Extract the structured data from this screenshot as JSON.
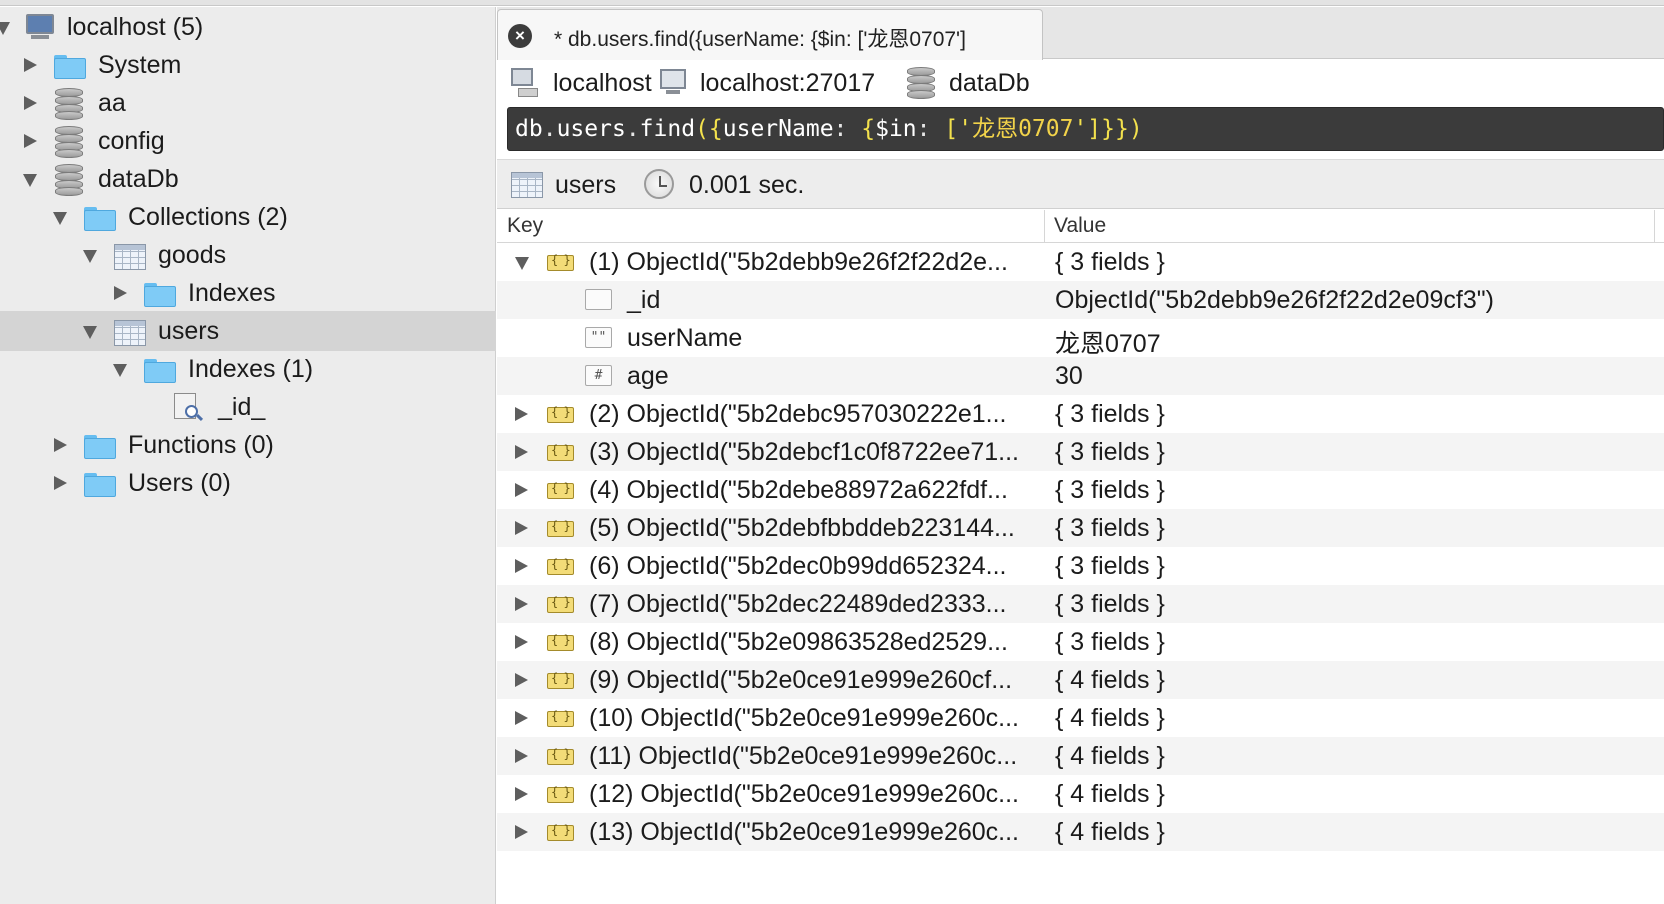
{
  "sidebar": {
    "host": {
      "label": "localhost (5)"
    },
    "items": [
      {
        "label": "System"
      },
      {
        "label": "aa"
      },
      {
        "label": "config"
      },
      {
        "label": "dataDb"
      },
      {
        "label": "Collections (2)"
      },
      {
        "label": "goods"
      },
      {
        "label": "Indexes"
      },
      {
        "label": "users"
      },
      {
        "label": "Indexes (1)"
      },
      {
        "label": "_id_"
      },
      {
        "label": "Functions (0)"
      },
      {
        "label": "Users (0)"
      }
    ]
  },
  "tab": {
    "title": "* db.users.find({userName: {$in: ['龙恩0707']",
    "close_icon": "×"
  },
  "connection": {
    "server": "localhost",
    "host": "localhost:27017",
    "database": "dataDb"
  },
  "query": {
    "p1": "db",
    "p2": ".",
    "p3": "users",
    "p4": ".",
    "p5": "find",
    "p6": "({",
    "p7": "userName",
    "p8": ": ",
    "p9": "{",
    "p10": "$in",
    "p11": ": ",
    "p12": "['",
    "p13": "龙恩0707",
    "p14": "']",
    "p15": "}})"
  },
  "result": {
    "collection": "users",
    "time": "0.001 sec."
  },
  "table": {
    "headers": {
      "key": "Key",
      "value": "Value"
    },
    "rows": [
      {
        "key": "(1) ObjectId(\"5b2debb9e26f2f22d2e...",
        "value": "{ 3 fields }"
      },
      {
        "key": "_id",
        "value": "ObjectId(\"5b2debb9e26f2f22d2e09cf3\")",
        "type_glyph": ""
      },
      {
        "key": "userName",
        "value": "龙恩0707",
        "type_glyph": "\"\""
      },
      {
        "key": "age",
        "value": "30",
        "type_glyph": "#"
      },
      {
        "key": "(2) ObjectId(\"5b2debc957030222e1...",
        "value": "{ 3 fields }"
      },
      {
        "key": "(3) ObjectId(\"5b2debcf1c0f8722ee71...",
        "value": "{ 3 fields }"
      },
      {
        "key": "(4) ObjectId(\"5b2debe88972a622fdf...",
        "value": "{ 3 fields }"
      },
      {
        "key": "(5) ObjectId(\"5b2debfbbddeb223144...",
        "value": "{ 3 fields }"
      },
      {
        "key": "(6) ObjectId(\"5b2dec0b99dd652324...",
        "value": "{ 3 fields }"
      },
      {
        "key": "(7) ObjectId(\"5b2dec22489ded2333...",
        "value": "{ 3 fields }"
      },
      {
        "key": "(8) ObjectId(\"5b2e09863528ed2529...",
        "value": "{ 3 fields }"
      },
      {
        "key": "(9) ObjectId(\"5b2e0ce91e999e260cf...",
        "value": "{ 4 fields }"
      },
      {
        "key": "(10) ObjectId(\"5b2e0ce91e999e260c...",
        "value": "{ 4 fields }"
      },
      {
        "key": "(11) ObjectId(\"5b2e0ce91e999e260c...",
        "value": "{ 4 fields }"
      },
      {
        "key": "(12) ObjectId(\"5b2e0ce91e999e260c...",
        "value": "{ 4 fields }"
      },
      {
        "key": "(13) ObjectId(\"5b2e0ce91e999e260c...",
        "value": "{ 4 fields }"
      }
    ]
  },
  "colors": {
    "query_bg": "#3b3b3b",
    "query_bracket": "#f3e14d",
    "folder": "#7fcbf6",
    "selected_row": "#d4d4d4"
  }
}
